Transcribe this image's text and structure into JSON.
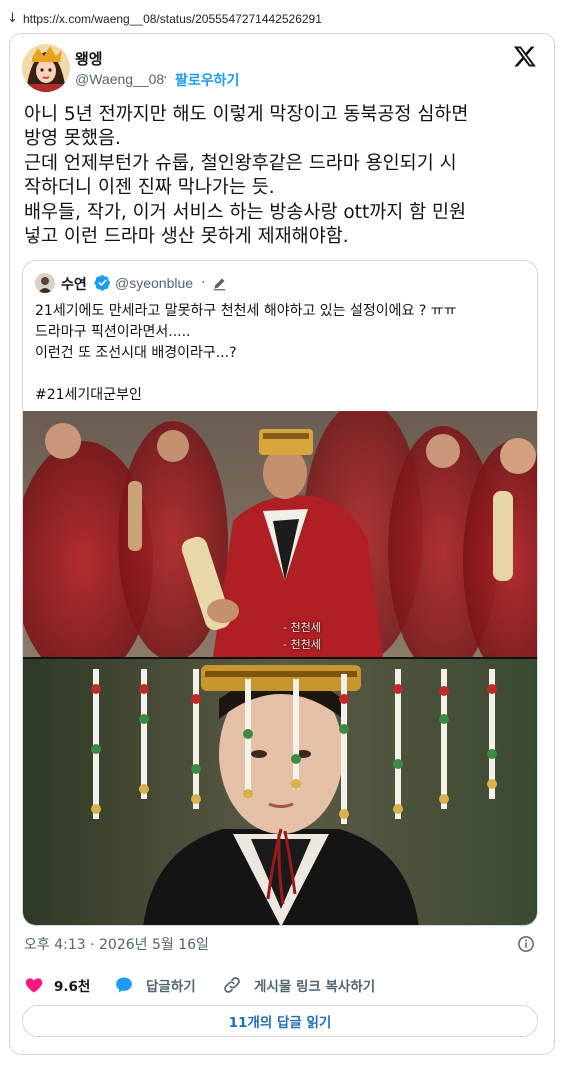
{
  "browser": {
    "arrow": "↓",
    "url": "https://x.com/waeng__08/status/2055547271442526291"
  },
  "tweet": {
    "author_name": "왱엥",
    "author_handle": "@Waeng__08",
    "dot": "·",
    "follow_label": "팔로우하기",
    "text": "아니 5년 전까지만 해도 이렇게 막장이고 동북공정 심하면\n방영 못했음.\n근데 언제부턴가 슈룹, 철인왕후같은 드라마 용인되기 시\n작하더니 이젠 진짜 막나가는 듯.\n배우들, 작가, 이거 서비스 하는 방송사랑 ott까지 함 민원\n넣고 이런 드라마 생산 못하게 제재해야함.",
    "timestamp": "오후 4:13 · 2026년 5월 16일"
  },
  "quote": {
    "author_name": "수연",
    "author_handle": "@syeonblue",
    "dot": "·",
    "text": "21세기에도 만세라고 말못하구 천천세 해야하고 있는 설정이에요 ? ㅠㅠ\n드라마구 픽션이라면서.....\n이런건 또 조선시대 배경이라구...?\n\n#21세기대군부인",
    "subtitle": "- 천천세\n- 천천세"
  },
  "actions": {
    "like_count": "9.6천",
    "reply_label": "답글하기",
    "copy_link_label": "게시물 링크 복사하기"
  },
  "read_replies_label": "11개의 답글 읽기",
  "icons": {
    "x_logo": "x-logo-icon",
    "verified": "verified-badge-icon",
    "edit": "edit-pencil-icon",
    "info": "info-icon",
    "like": "heart-icon",
    "reply": "speech-bubble-icon",
    "copy_link": "link-icon"
  },
  "colors": {
    "accent": "#1d9bf0",
    "like": "#f91880",
    "muted": "#536471",
    "border": "#cfd9de"
  }
}
